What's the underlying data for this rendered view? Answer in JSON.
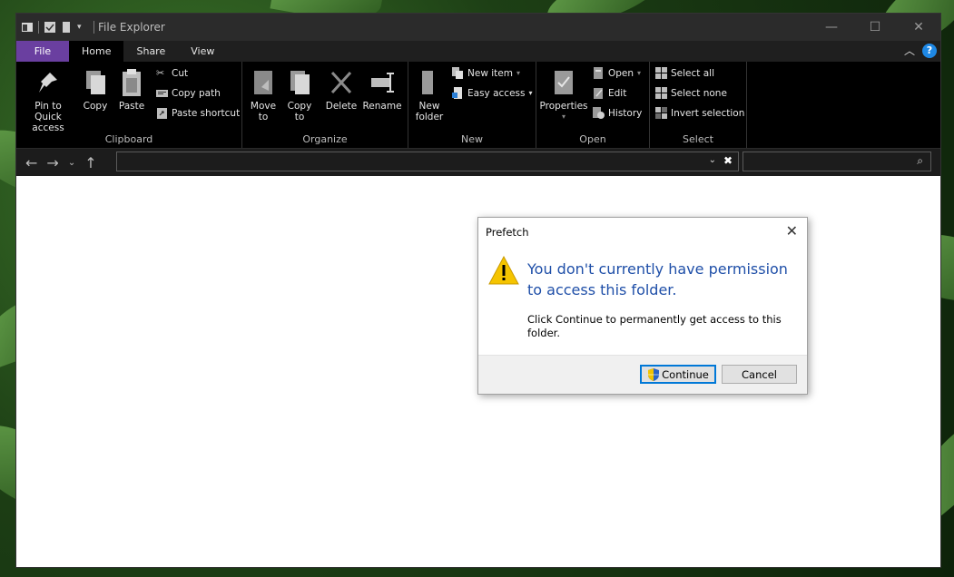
{
  "window": {
    "title": "File Explorer",
    "controls": {
      "minimize": "—",
      "maximize": "☐",
      "close": "✕"
    }
  },
  "tabs": [
    {
      "label": "File"
    },
    {
      "label": "Home"
    },
    {
      "label": "Share"
    },
    {
      "label": "View"
    }
  ],
  "ribbon": {
    "clipboard": {
      "label": "Clipboard",
      "pin": "Pin to Quick access",
      "copy": "Copy",
      "paste": "Paste",
      "cut": "Cut",
      "copy_path": "Copy path",
      "paste_shortcut": "Paste shortcut"
    },
    "organize": {
      "label": "Organize",
      "move_to": "Move to",
      "copy_to": "Copy to",
      "delete": "Delete",
      "rename": "Rename"
    },
    "new": {
      "label": "New",
      "new_folder": "New folder",
      "new_item": "New item",
      "easy_access": "Easy access"
    },
    "open": {
      "label": "Open",
      "properties": "Properties",
      "open": "Open",
      "edit": "Edit",
      "history": "History"
    },
    "select": {
      "label": "Select",
      "select_all": "Select all",
      "select_none": "Select none",
      "invert_selection": "Invert selection"
    }
  },
  "address": {
    "value": "",
    "placeholder": ""
  },
  "search": {
    "value": "",
    "placeholder": ""
  },
  "dialog": {
    "title": "Prefetch",
    "heading": "You don't currently have permission to access this folder.",
    "message": "Click Continue to permanently get access to this folder.",
    "continue_label": "Continue",
    "cancel_label": "Cancel"
  },
  "colors": {
    "file_tab": "#6a3fa0",
    "ribbon_bg": "#000000",
    "dialog_heading": "#1f4fa8",
    "primary_border": "#0078d7",
    "warning_yellow": "#f5c400"
  }
}
